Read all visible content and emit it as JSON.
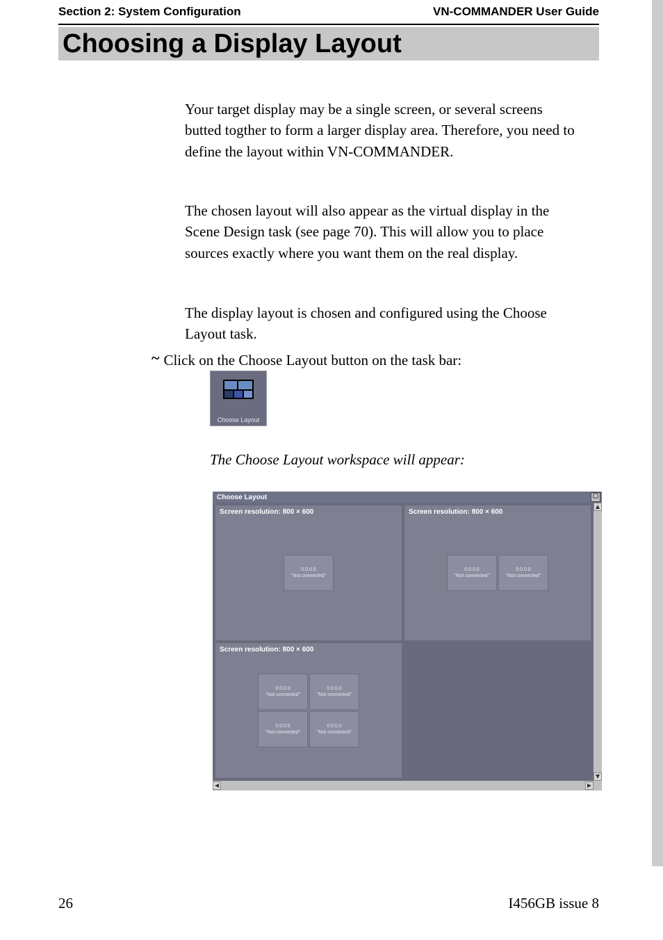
{
  "header": {
    "section": "Section 2: System Configuration",
    "guide": "VN-COMMANDER User Guide"
  },
  "title": "Choosing a Display Layout",
  "paragraphs": {
    "p1": "Your target display may be a single screen, or several screens butted togther to form a larger display area. Therefore, you need to define the layout within VN-COMMANDER.",
    "p2": "The chosen layout will also appear as the virtual display in the Scene Design task (see page 70). This will allow you to place sources exactly where you want them on the real display.",
    "p3": "The display layout is chosen and configured using the Choose Layout task."
  },
  "step": {
    "text": "Click on the Choose Layout button on the task bar:"
  },
  "taskbar_icon_label": "Choose Layout",
  "caption": "The Choose Layout workspace will appear:",
  "screenshot": {
    "title": "Choose Layout",
    "panels": [
      {
        "label": "Screen resolution: 800 × 600",
        "rows": 1,
        "cols": 1
      },
      {
        "label": "Screen resolution: 800 × 600",
        "rows": 1,
        "cols": 2
      },
      {
        "label": "Screen resolution: 800 × 600",
        "rows": 2,
        "cols": 2
      },
      {
        "label": "",
        "rows": 0,
        "cols": 0
      }
    ],
    "display_box": {
      "ip": "0.0.0.0",
      "status": "\"Not connected\""
    }
  },
  "footer": {
    "page": "26",
    "issue": "I456GB issue 8"
  }
}
